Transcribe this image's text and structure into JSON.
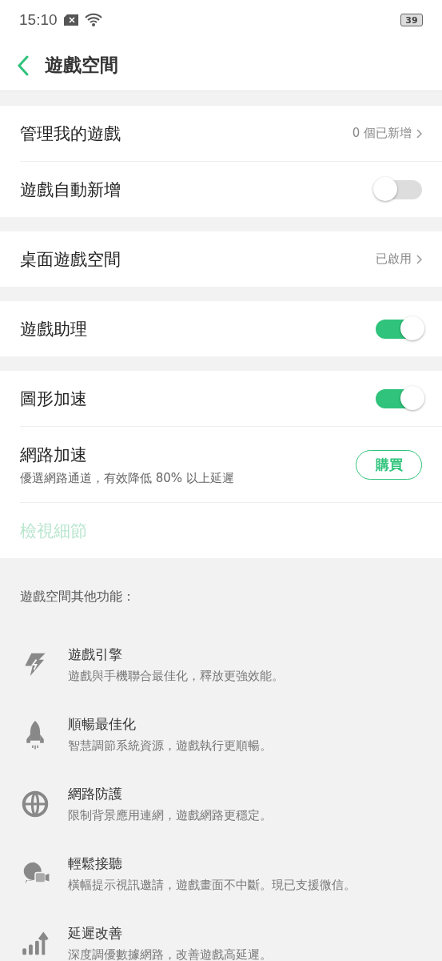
{
  "status_bar": {
    "time": "15:10",
    "battery": "39"
  },
  "header": {
    "title": "遊戲空間"
  },
  "groups": [
    {
      "rows": [
        {
          "kind": "link",
          "label": "管理我的遊戲",
          "value": "0 個已新增"
        },
        {
          "kind": "toggle",
          "label": "遊戲自動新增",
          "on": false
        }
      ]
    },
    {
      "rows": [
        {
          "kind": "link",
          "label": "桌面遊戲空間",
          "value": "已啟用"
        }
      ]
    },
    {
      "rows": [
        {
          "kind": "toggle",
          "label": "遊戲助理",
          "on": true
        }
      ]
    },
    {
      "rows": [
        {
          "kind": "toggle",
          "label": "圖形加速",
          "on": true
        },
        {
          "kind": "button",
          "label": "網路加速",
          "description": "優選網路通道，有效降低 80% 以上延遲",
          "button": "購買"
        },
        {
          "kind": "details",
          "label": "檢視細節",
          "disabled": true
        }
      ]
    }
  ],
  "features": {
    "heading": "遊戲空間其他功能：",
    "items": [
      {
        "title": "遊戲引擎",
        "description": "遊戲與手機聯合最佳化，釋放更強效能。"
      },
      {
        "title": "順暢最佳化",
        "description": "智慧調節系統資源，遊戲執行更順暢。"
      },
      {
        "title": "網路防護",
        "description": "限制背景應用連網，遊戲網路更穩定。"
      },
      {
        "title": "輕鬆接聽",
        "description": "橫幅提示視訊邀請，遊戲畫面不中斷。現已支援微信。"
      },
      {
        "title": "延遲改善",
        "description": "深度調優數據網路，改善遊戲高延遲。"
      }
    ]
  }
}
